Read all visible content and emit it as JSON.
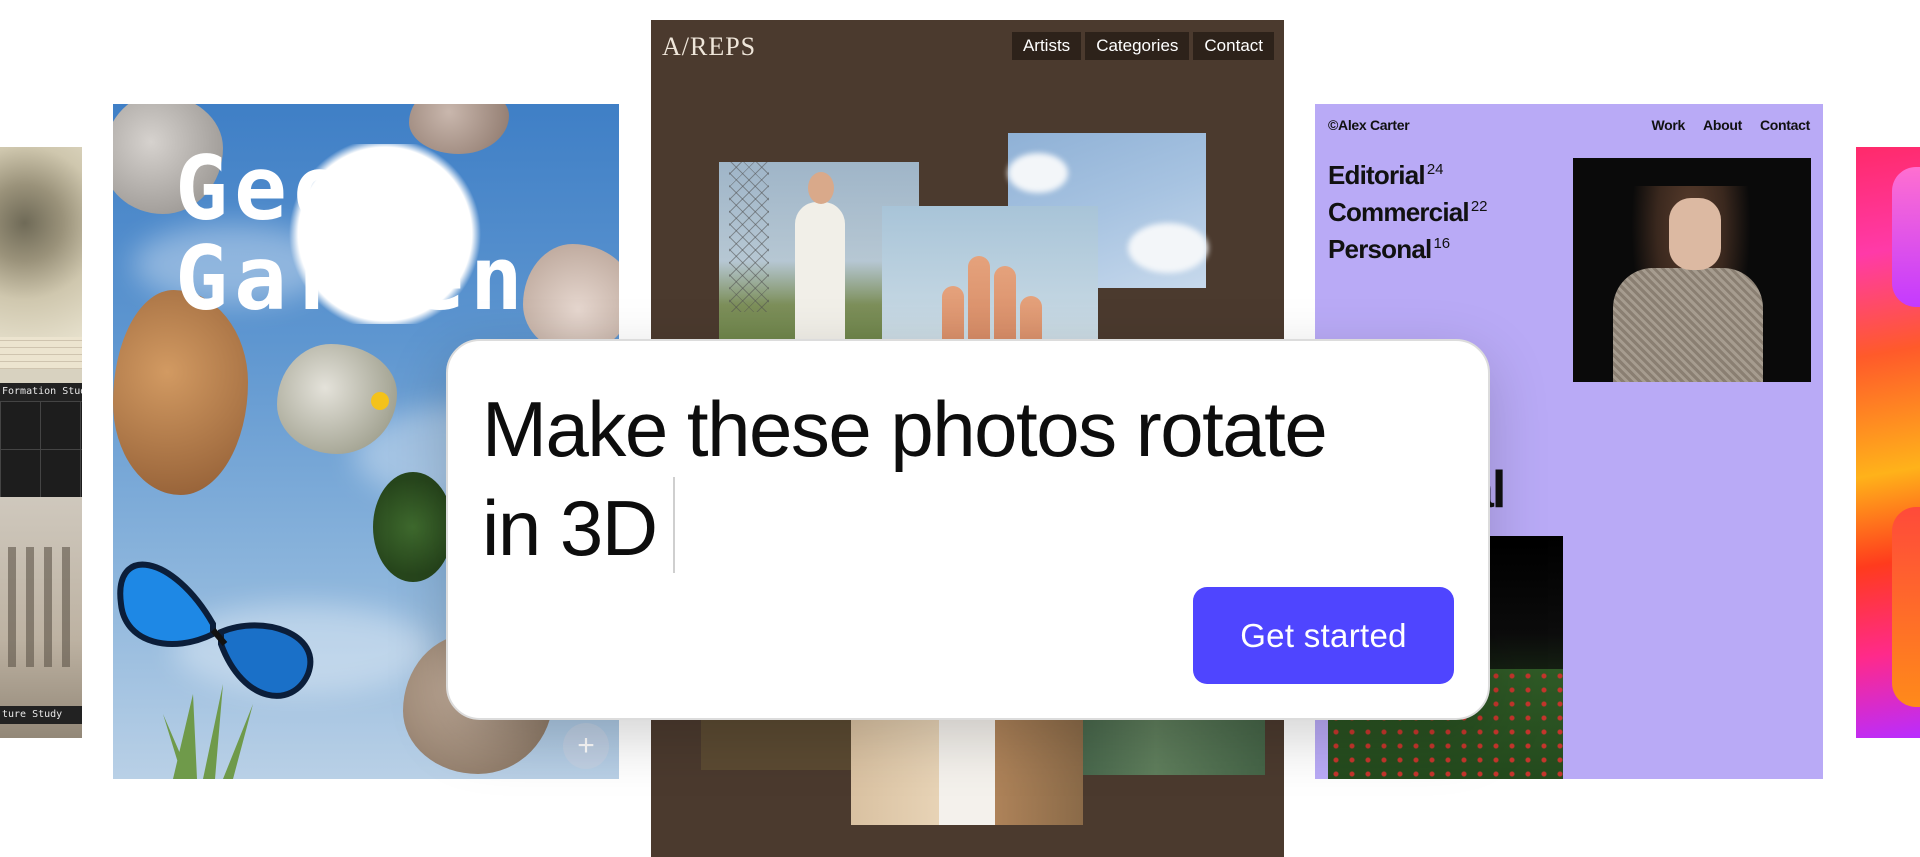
{
  "left_card": {
    "caption_top": "Formation Study",
    "caption_bottom": "ture Study"
  },
  "geo_card": {
    "title_line1": "Geo",
    "title_line2": "Garden",
    "plus_icon": "+"
  },
  "reps_card": {
    "brand": "A/REPS",
    "nav": [
      "Artists",
      "Categories",
      "Contact"
    ]
  },
  "alex_card": {
    "logo": "©Alex Carter",
    "nav": [
      "Work",
      "About",
      "Contact"
    ],
    "categories": [
      {
        "label": "Editorial",
        "count": "24"
      },
      {
        "label": "Commercial",
        "count": "22"
      },
      {
        "label": "Personal",
        "count": "16"
      }
    ],
    "big_text": "al",
    "accent": "#b9aaf6"
  },
  "prompt": {
    "text_line1": "Make these photos rotate",
    "text_line2": "in 3D",
    "cta_label": "Get started",
    "cta_color": "#4f45ff"
  }
}
